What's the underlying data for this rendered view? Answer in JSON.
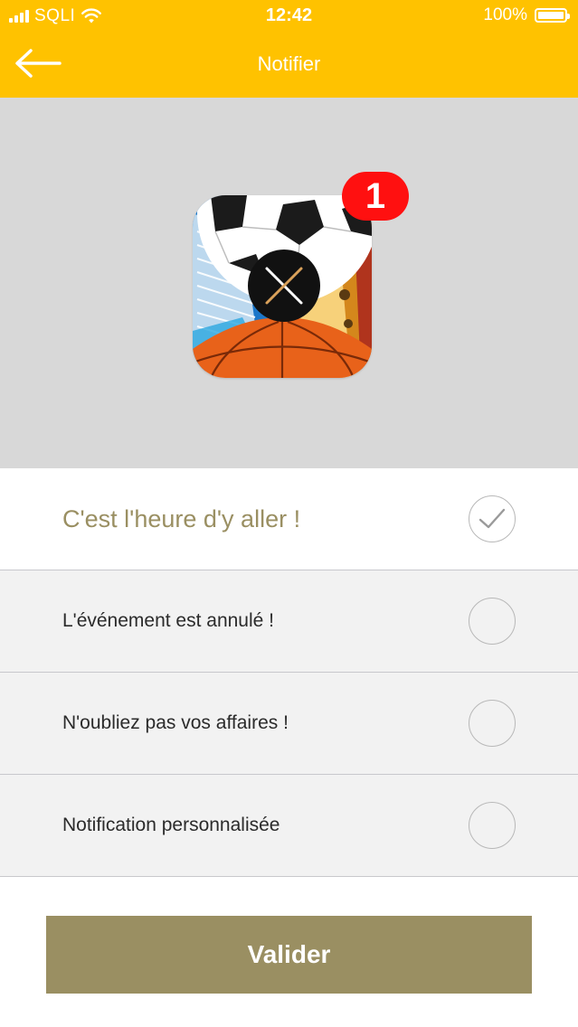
{
  "status_bar": {
    "carrier": "SQLI",
    "time": "12:42",
    "battery": "100%",
    "icons": [
      "signal-bars-icon",
      "wifi-icon",
      "battery-icon"
    ]
  },
  "nav": {
    "back_icon": "arrow-left-icon",
    "title": "Notifier"
  },
  "hero": {
    "icon": "sports-app-icon",
    "badge_count": "1"
  },
  "options": [
    {
      "label": "C'est l'heure d'y aller !",
      "selected": true
    },
    {
      "label": "L'événement est annulé !",
      "selected": false
    },
    {
      "label": "N'oubliez pas vos affaires !",
      "selected": false
    },
    {
      "label": "Notification personnalisée",
      "selected": false
    }
  ],
  "submit": {
    "label": "Valider"
  },
  "colors": {
    "header": "#FFC200",
    "accent": "#9a8f62",
    "badge": "#FF1010",
    "hero_background": "#d8d8d8"
  }
}
